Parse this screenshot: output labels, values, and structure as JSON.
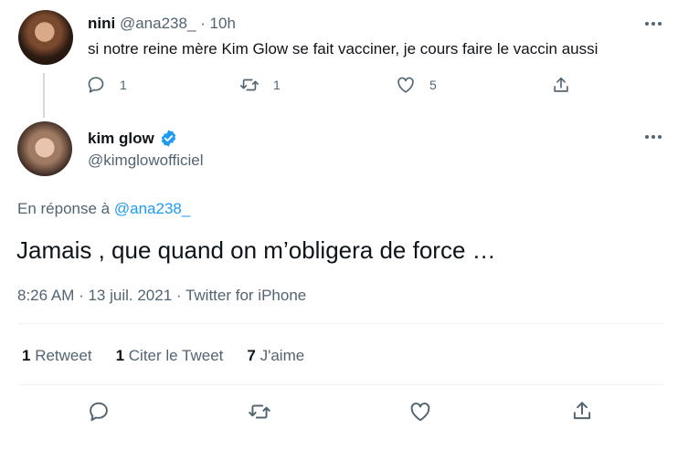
{
  "parent_tweet": {
    "display_name": "nini",
    "handle": "@ana238_",
    "separator": "·",
    "time": "10h",
    "text": "si notre reine mère Kim Glow se fait vacciner, je cours faire le vaccin aussi",
    "reply_count": "1",
    "retweet_count": "1",
    "like_count": "5",
    "avatar_icon": "avatar-photo"
  },
  "main_tweet": {
    "display_name": "kim glow",
    "handle": "@kimglowofficiel",
    "verified": true,
    "reply_prefix": "En réponse à",
    "reply_to": "@ana238_",
    "text": "Jamais , que quand on m’obligera de force …",
    "meta": "8:26 AM · 13 juil. 2021 · Twitter for iPhone",
    "stats": {
      "retweets_count": "1",
      "retweets_label": "Retweet",
      "quotes_count": "1",
      "quotes_label": "Citer le Tweet",
      "likes_count": "7",
      "likes_label": "J'aime"
    }
  },
  "colors": {
    "text": "#0f1419",
    "muted": "#536471",
    "link": "#1d9bf0",
    "verified": "#1d9bf0",
    "divider": "#eff3f4"
  }
}
